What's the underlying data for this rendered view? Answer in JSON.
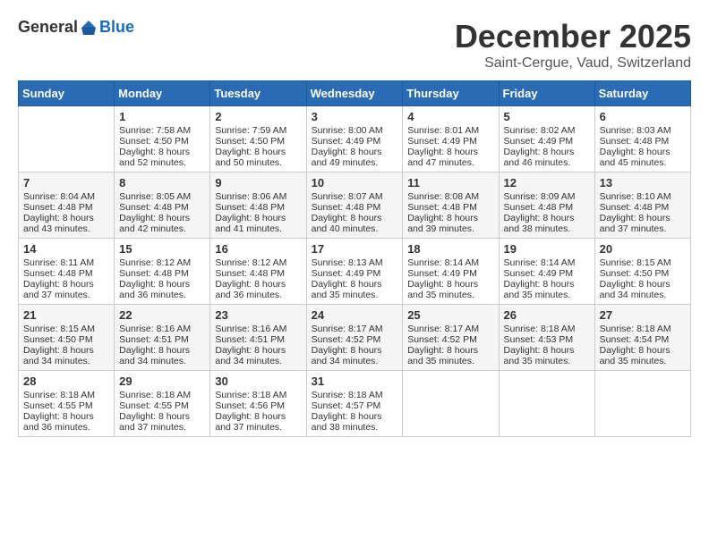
{
  "header": {
    "logo_general": "General",
    "logo_blue": "Blue",
    "month": "December 2025",
    "location": "Saint-Cergue, Vaud, Switzerland"
  },
  "days_of_week": [
    "Sunday",
    "Monday",
    "Tuesday",
    "Wednesday",
    "Thursday",
    "Friday",
    "Saturday"
  ],
  "weeks": [
    [
      {
        "day": "",
        "content": ""
      },
      {
        "day": "1",
        "content": "Sunrise: 7:58 AM\nSunset: 4:50 PM\nDaylight: 8 hours\nand 52 minutes."
      },
      {
        "day": "2",
        "content": "Sunrise: 7:59 AM\nSunset: 4:50 PM\nDaylight: 8 hours\nand 50 minutes."
      },
      {
        "day": "3",
        "content": "Sunrise: 8:00 AM\nSunset: 4:49 PM\nDaylight: 8 hours\nand 49 minutes."
      },
      {
        "day": "4",
        "content": "Sunrise: 8:01 AM\nSunset: 4:49 PM\nDaylight: 8 hours\nand 47 minutes."
      },
      {
        "day": "5",
        "content": "Sunrise: 8:02 AM\nSunset: 4:49 PM\nDaylight: 8 hours\nand 46 minutes."
      },
      {
        "day": "6",
        "content": "Sunrise: 8:03 AM\nSunset: 4:48 PM\nDaylight: 8 hours\nand 45 minutes."
      }
    ],
    [
      {
        "day": "7",
        "content": "Sunrise: 8:04 AM\nSunset: 4:48 PM\nDaylight: 8 hours\nand 43 minutes."
      },
      {
        "day": "8",
        "content": "Sunrise: 8:05 AM\nSunset: 4:48 PM\nDaylight: 8 hours\nand 42 minutes."
      },
      {
        "day": "9",
        "content": "Sunrise: 8:06 AM\nSunset: 4:48 PM\nDaylight: 8 hours\nand 41 minutes."
      },
      {
        "day": "10",
        "content": "Sunrise: 8:07 AM\nSunset: 4:48 PM\nDaylight: 8 hours\nand 40 minutes."
      },
      {
        "day": "11",
        "content": "Sunrise: 8:08 AM\nSunset: 4:48 PM\nDaylight: 8 hours\nand 39 minutes."
      },
      {
        "day": "12",
        "content": "Sunrise: 8:09 AM\nSunset: 4:48 PM\nDaylight: 8 hours\nand 38 minutes."
      },
      {
        "day": "13",
        "content": "Sunrise: 8:10 AM\nSunset: 4:48 PM\nDaylight: 8 hours\nand 37 minutes."
      }
    ],
    [
      {
        "day": "14",
        "content": "Sunrise: 8:11 AM\nSunset: 4:48 PM\nDaylight: 8 hours\nand 37 minutes."
      },
      {
        "day": "15",
        "content": "Sunrise: 8:12 AM\nSunset: 4:48 PM\nDaylight: 8 hours\nand 36 minutes."
      },
      {
        "day": "16",
        "content": "Sunrise: 8:12 AM\nSunset: 4:48 PM\nDaylight: 8 hours\nand 36 minutes."
      },
      {
        "day": "17",
        "content": "Sunrise: 8:13 AM\nSunset: 4:49 PM\nDaylight: 8 hours\nand 35 minutes."
      },
      {
        "day": "18",
        "content": "Sunrise: 8:14 AM\nSunset: 4:49 PM\nDaylight: 8 hours\nand 35 minutes."
      },
      {
        "day": "19",
        "content": "Sunrise: 8:14 AM\nSunset: 4:49 PM\nDaylight: 8 hours\nand 35 minutes."
      },
      {
        "day": "20",
        "content": "Sunrise: 8:15 AM\nSunset: 4:50 PM\nDaylight: 8 hours\nand 34 minutes."
      }
    ],
    [
      {
        "day": "21",
        "content": "Sunrise: 8:15 AM\nSunset: 4:50 PM\nDaylight: 8 hours\nand 34 minutes."
      },
      {
        "day": "22",
        "content": "Sunrise: 8:16 AM\nSunset: 4:51 PM\nDaylight: 8 hours\nand 34 minutes."
      },
      {
        "day": "23",
        "content": "Sunrise: 8:16 AM\nSunset: 4:51 PM\nDaylight: 8 hours\nand 34 minutes."
      },
      {
        "day": "24",
        "content": "Sunrise: 8:17 AM\nSunset: 4:52 PM\nDaylight: 8 hours\nand 34 minutes."
      },
      {
        "day": "25",
        "content": "Sunrise: 8:17 AM\nSunset: 4:52 PM\nDaylight: 8 hours\nand 35 minutes."
      },
      {
        "day": "26",
        "content": "Sunrise: 8:18 AM\nSunset: 4:53 PM\nDaylight: 8 hours\nand 35 minutes."
      },
      {
        "day": "27",
        "content": "Sunrise: 8:18 AM\nSunset: 4:54 PM\nDaylight: 8 hours\nand 35 minutes."
      }
    ],
    [
      {
        "day": "28",
        "content": "Sunrise: 8:18 AM\nSunset: 4:55 PM\nDaylight: 8 hours\nand 36 minutes."
      },
      {
        "day": "29",
        "content": "Sunrise: 8:18 AM\nSunset: 4:55 PM\nDaylight: 8 hours\nand 37 minutes."
      },
      {
        "day": "30",
        "content": "Sunrise: 8:18 AM\nSunset: 4:56 PM\nDaylight: 8 hours\nand 37 minutes."
      },
      {
        "day": "31",
        "content": "Sunrise: 8:18 AM\nSunset: 4:57 PM\nDaylight: 8 hours\nand 38 minutes."
      },
      {
        "day": "",
        "content": ""
      },
      {
        "day": "",
        "content": ""
      },
      {
        "day": "",
        "content": ""
      }
    ]
  ]
}
